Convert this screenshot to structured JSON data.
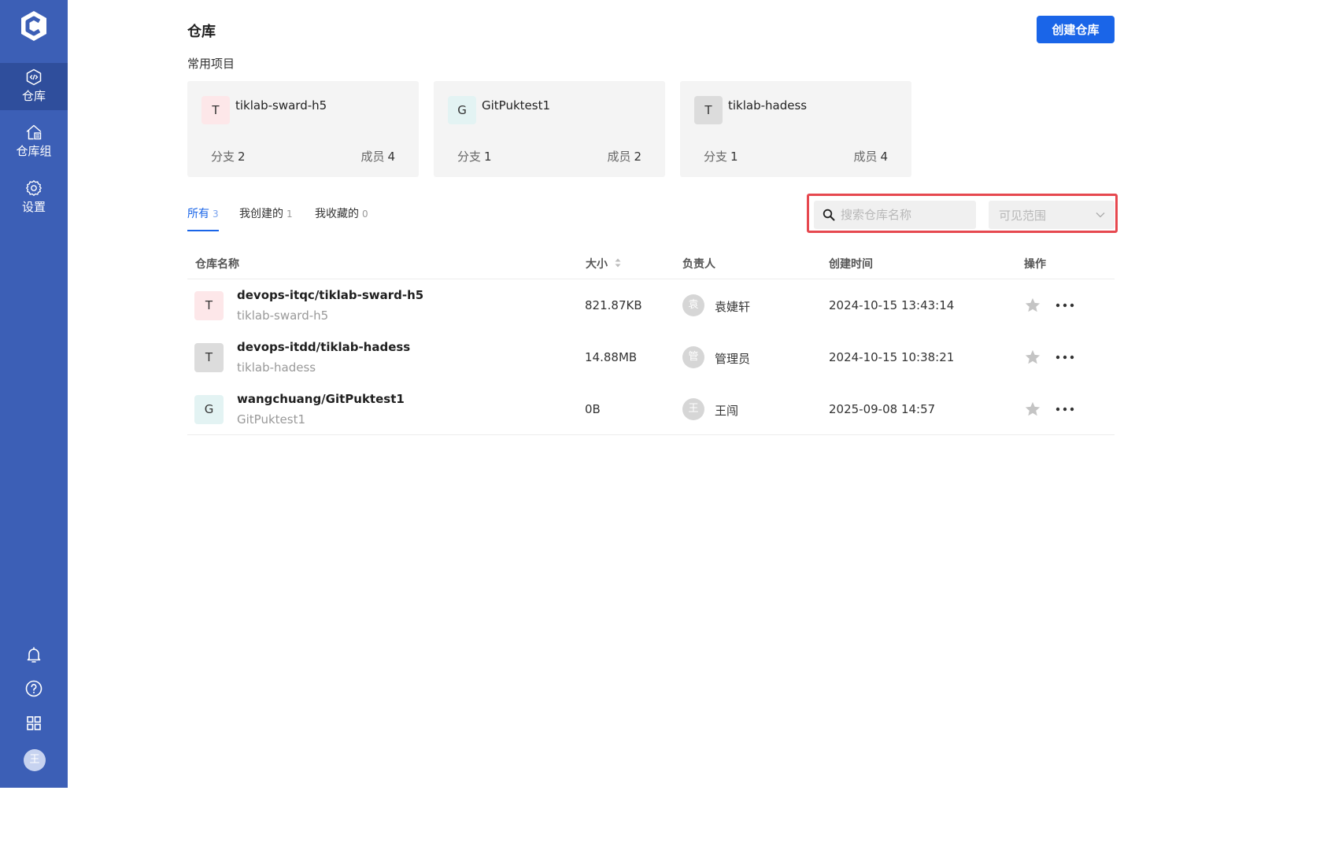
{
  "colors": {
    "sidebar": "#3c5fb6",
    "sidebar_active": "#2f4e9c",
    "primary": "#1a65e8",
    "highlight_border": "#e6484f"
  },
  "sidebar": {
    "items": [
      {
        "label": "仓库",
        "icon": "repository-code-icon",
        "active": true
      },
      {
        "label": "仓库组",
        "icon": "repository-group-icon",
        "active": false
      },
      {
        "label": "设置",
        "icon": "gear-icon",
        "active": false
      }
    ],
    "bottom_icons": [
      "bell-icon",
      "help-circle-icon",
      "app-grid-icon"
    ],
    "user_avatar": "王"
  },
  "header": {
    "title": "仓库",
    "create_button": "创建仓库"
  },
  "recent": {
    "title": "常用项目",
    "cards": [
      {
        "avatar": "T",
        "avatar_bg": "#fde7e9",
        "name": "tiklab-sward-h5",
        "branch_label": "分支",
        "branch_count": "2",
        "member_label": "成员",
        "member_count": "4"
      },
      {
        "avatar": "G",
        "avatar_bg": "#e3f3f3",
        "name": "GitPuktest1",
        "branch_label": "分支",
        "branch_count": "1",
        "member_label": "成员",
        "member_count": "2"
      },
      {
        "avatar": "T",
        "avatar_bg": "#dcdcdc",
        "name": "tiklab-hadess",
        "branch_label": "分支",
        "branch_count": "1",
        "member_label": "成员",
        "member_count": "4"
      }
    ]
  },
  "tabs": [
    {
      "label": "所有",
      "count": "3",
      "active": true
    },
    {
      "label": "我创建的",
      "count": "1",
      "active": false
    },
    {
      "label": "我收藏的",
      "count": "0",
      "active": false
    }
  ],
  "filter": {
    "search_placeholder": "搜索仓库名称",
    "scope_placeholder": "可见范围"
  },
  "table": {
    "columns": {
      "name": "仓库名称",
      "size": "大小",
      "owner": "负责人",
      "created": "创建时间",
      "actions": "操作"
    },
    "rows": [
      {
        "avatar": "T",
        "avatar_bg": "#fde7e9",
        "full_name": "devops-itqc/tiklab-sward-h5",
        "name": "tiklab-sward-h5",
        "size": "821.87KB",
        "owner_avatar": "袁",
        "owner": "袁婕轩",
        "created": "2024-10-15 13:43:14"
      },
      {
        "avatar": "T",
        "avatar_bg": "#dcdcdc",
        "full_name": "devops-itdd/tiklab-hadess",
        "name": "tiklab-hadess",
        "size": "14.88MB",
        "owner_avatar": "管",
        "owner": "管理员",
        "created": "2024-10-15 10:38:21"
      },
      {
        "avatar": "G",
        "avatar_bg": "#e3f3f3",
        "full_name": "wangchuang/GitPuktest1",
        "name": "GitPuktest1",
        "size": "0B",
        "owner_avatar": "王",
        "owner": "王闯",
        "created": "2025-09-08 14:57"
      }
    ]
  }
}
